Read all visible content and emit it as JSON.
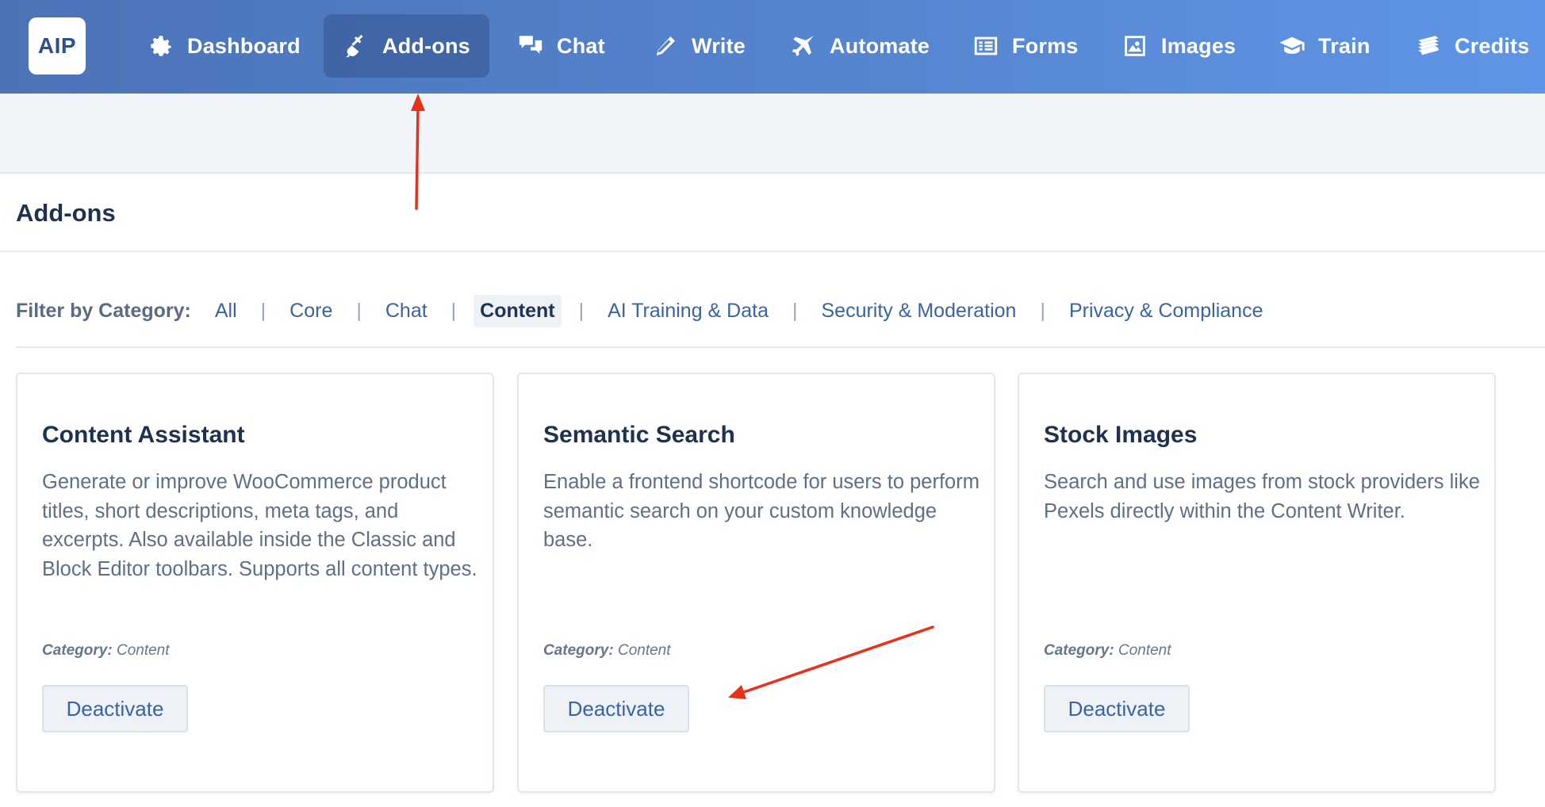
{
  "app": {
    "logo_text": "AIP"
  },
  "nav": {
    "items": [
      {
        "label": "Dashboard",
        "icon": "gear-icon",
        "active": false
      },
      {
        "label": "Add-ons",
        "icon": "plug-icon",
        "active": true
      },
      {
        "label": "Chat",
        "icon": "chat-icon",
        "active": false
      },
      {
        "label": "Write",
        "icon": "pencil-icon",
        "active": false
      },
      {
        "label": "Automate",
        "icon": "plane-icon",
        "active": false
      },
      {
        "label": "Forms",
        "icon": "form-icon",
        "active": false
      },
      {
        "label": "Images",
        "icon": "image-icon",
        "active": false
      },
      {
        "label": "Train",
        "icon": "graduation-cap-icon",
        "active": false
      },
      {
        "label": "Credits",
        "icon": "money-stack-icon",
        "active": false
      }
    ]
  },
  "page": {
    "title": "Add-ons"
  },
  "filter": {
    "label": "Filter by Category:",
    "separator": "|",
    "items": [
      {
        "label": "All",
        "active": false
      },
      {
        "label": "Core",
        "active": false
      },
      {
        "label": "Chat",
        "active": false
      },
      {
        "label": "Content",
        "active": true
      },
      {
        "label": "AI Training & Data",
        "active": false
      },
      {
        "label": "Security & Moderation",
        "active": false
      },
      {
        "label": "Privacy & Compliance",
        "active": false
      }
    ]
  },
  "cards": [
    {
      "title": "Content Assistant",
      "description": "Generate or improve WooCommerce product titles, short descriptions, meta tags, and excerpts. Also available inside the Classic and Block Editor toolbars. Supports all content types.",
      "category_label": "Category:",
      "category": "Content",
      "button": "Deactivate"
    },
    {
      "title": "Semantic Search",
      "description": "Enable a frontend shortcode for users to perform semantic search on your custom knowledge base.",
      "category_label": "Category:",
      "category": "Content",
      "button": "Deactivate"
    },
    {
      "title": "Stock Images",
      "description": "Search and use images from stock providers like Pexels directly within the Content Writer.",
      "category_label": "Category:",
      "category": "Content",
      "button": "Deactivate"
    }
  ],
  "colors": {
    "header_start": "#4b73b8",
    "header_end": "#5f95e6",
    "link": "#3b63a3",
    "annotation_arrow": "#e8311c"
  }
}
